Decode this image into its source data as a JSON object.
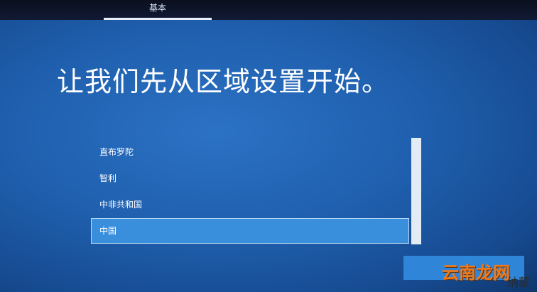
{
  "tabs": [
    {
      "label": "基本"
    }
  ],
  "heading": "让我们先从区域设置开始。",
  "region_list": {
    "items": [
      {
        "label": "直布罗陀",
        "selected": false
      },
      {
        "label": "智利",
        "selected": false
      },
      {
        "label": "中非共和国",
        "selected": false
      },
      {
        "label": "中国",
        "selected": true
      }
    ]
  },
  "watermark": {
    "text": "云南龙网",
    "sub": "纳蒙"
  },
  "colors": {
    "background": "#1f5fae",
    "selection": "#3a8fdc",
    "button": "#2f86d8",
    "watermark": "#f07a1a"
  }
}
